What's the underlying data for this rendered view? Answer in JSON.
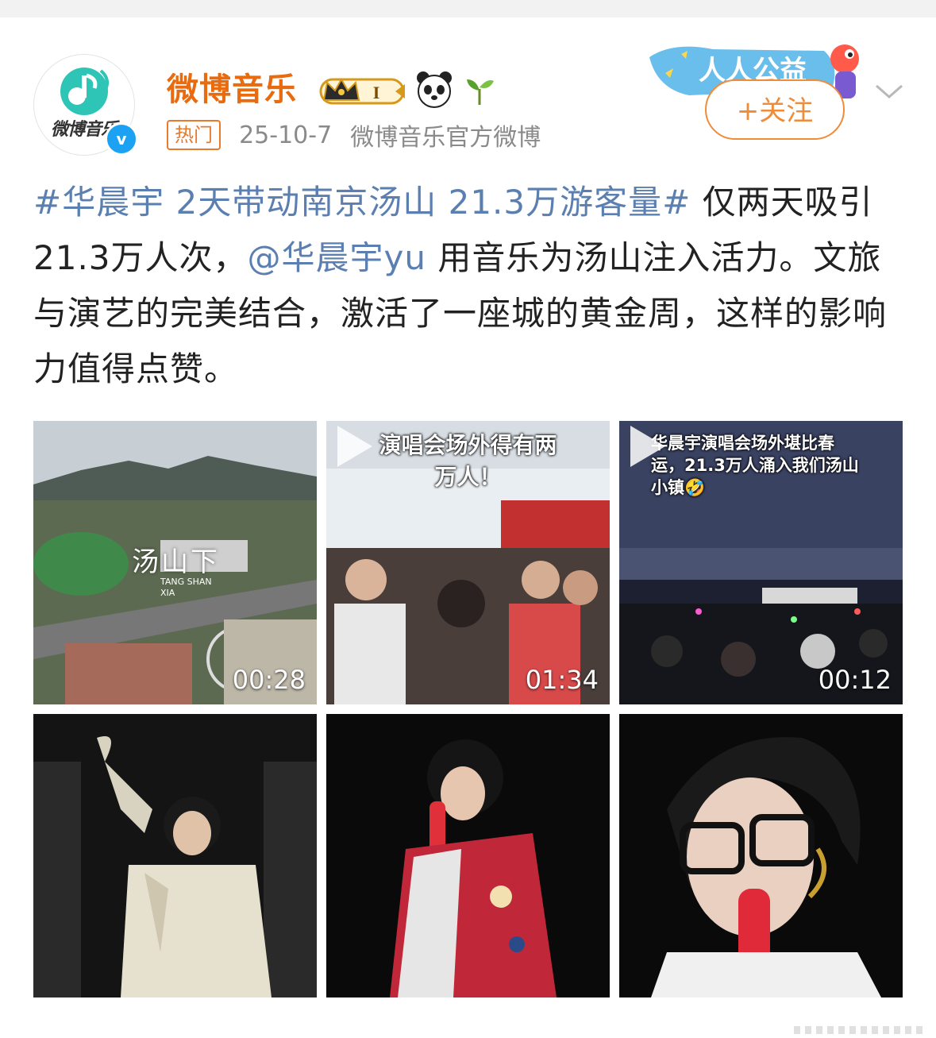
{
  "post": {
    "author": {
      "name": "微博音乐",
      "avatar_text": "微博音乐",
      "verified": "v",
      "level_badge": "I"
    },
    "meta": {
      "hot_tag": "热门",
      "date": "25-10-7",
      "source": "微博音乐官方微博"
    },
    "promo": {
      "label": "人人公益"
    },
    "follow_label": "+关注",
    "text": {
      "topic": "#华晨宇 2天带动南京汤山 21.3万游客量#",
      "part1": " 仅两天吸引 21.3万人次，",
      "mention": "@华晨宇yu",
      "part2": " 用音乐为汤山注入活力。文旅与演艺的完美结合，激活了一座城的黄金周，这样的影响力值得点赞。"
    },
    "media": [
      {
        "type": "video",
        "duration": "00:28",
        "watermark": "汤山下",
        "watermark_sub": "TANG SHAN XIA"
      },
      {
        "type": "video",
        "duration": "01:34",
        "caption_line1": "演唱会场外得有两",
        "caption_line2": "万人！"
      },
      {
        "type": "video",
        "duration": "00:12",
        "caption_line1": "华晨宇演唱会场外堪比春",
        "caption_line2": "运，21.3万人涌入我们汤山",
        "caption_line3": "小镇🤣"
      },
      {
        "type": "image"
      },
      {
        "type": "image"
      },
      {
        "type": "image"
      }
    ]
  },
  "colors": {
    "username": "#e86b0f",
    "link": "#5a7fb0",
    "follow": "#f08b38",
    "meta": "#8a8a8a"
  }
}
